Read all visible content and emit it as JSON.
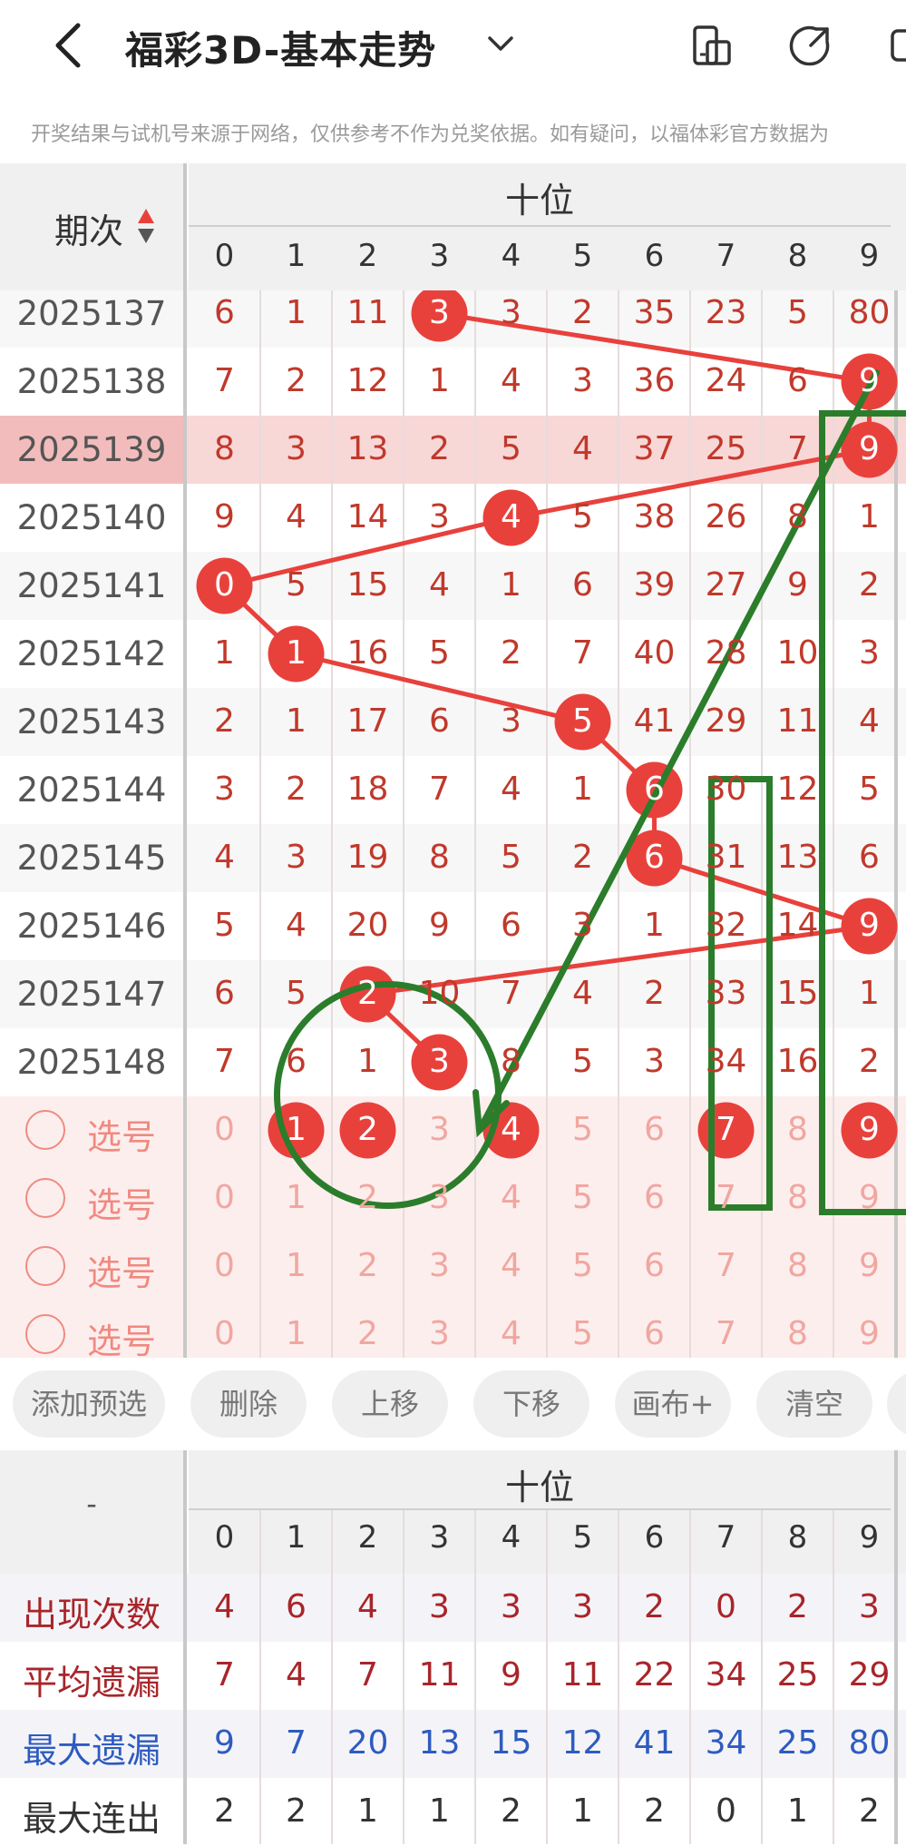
{
  "topbar": {
    "title": "福彩3D-基本走势",
    "back_icon": "chevron-left-icon",
    "dropdown_icon": "chevron-down-icon",
    "icons": [
      "phone-rotate-icon",
      "share-arrow-icon",
      "partial-icon"
    ]
  },
  "notice": "开奖结果与试机号来源于网络，仅供参考不作为兑奖依据。如有疑问，以福体彩官方数据为",
  "grid": {
    "period_header": "期次",
    "group_header": "十位",
    "digits": [
      "0",
      "1",
      "2",
      "3",
      "4",
      "5",
      "6",
      "7",
      "8",
      "9"
    ],
    "rows": [
      {
        "period": "2025137",
        "cells": [
          "6",
          "1",
          "11",
          "3",
          "3",
          "2",
          "35",
          "23",
          "5",
          "80"
        ],
        "hit": 3
      },
      {
        "period": "2025138",
        "cells": [
          "7",
          "2",
          "12",
          "1",
          "4",
          "3",
          "36",
          "24",
          "6",
          "9"
        ],
        "hit": 9
      },
      {
        "period": "2025139",
        "cells": [
          "8",
          "3",
          "13",
          "2",
          "5",
          "4",
          "37",
          "25",
          "7",
          "9"
        ],
        "hit": 9,
        "highlight": true
      },
      {
        "period": "2025140",
        "cells": [
          "9",
          "4",
          "14",
          "3",
          "4",
          "5",
          "38",
          "26",
          "8",
          "1"
        ],
        "hit": 4
      },
      {
        "period": "2025141",
        "cells": [
          "0",
          "5",
          "15",
          "4",
          "1",
          "6",
          "39",
          "27",
          "9",
          "2"
        ],
        "hit": 0
      },
      {
        "period": "2025142",
        "cells": [
          "1",
          "1",
          "16",
          "5",
          "2",
          "7",
          "40",
          "28",
          "10",
          "3"
        ],
        "hit": 1
      },
      {
        "period": "2025143",
        "cells": [
          "2",
          "1",
          "17",
          "6",
          "3",
          "5",
          "41",
          "29",
          "11",
          "4"
        ],
        "hit": 5
      },
      {
        "period": "2025144",
        "cells": [
          "3",
          "2",
          "18",
          "7",
          "4",
          "1",
          "6",
          "30",
          "12",
          "5"
        ],
        "hit": 6
      },
      {
        "period": "2025145",
        "cells": [
          "4",
          "3",
          "19",
          "8",
          "5",
          "2",
          "6",
          "31",
          "13",
          "6"
        ],
        "hit": 6
      },
      {
        "period": "2025146",
        "cells": [
          "5",
          "4",
          "20",
          "9",
          "6",
          "3",
          "1",
          "32",
          "14",
          "9"
        ],
        "hit": 9
      },
      {
        "period": "2025147",
        "cells": [
          "6",
          "5",
          "2",
          "10",
          "7",
          "4",
          "2",
          "33",
          "15",
          "1"
        ],
        "hit": 2
      },
      {
        "period": "2025148",
        "cells": [
          "7",
          "6",
          "1",
          "3",
          "8",
          "5",
          "3",
          "34",
          "16",
          "2"
        ],
        "hit": 3
      }
    ],
    "picks": [
      {
        "label": "选号",
        "selected": [
          1,
          2,
          4,
          7,
          9
        ]
      },
      {
        "label": "选号",
        "selected": []
      },
      {
        "label": "选号",
        "selected": []
      },
      {
        "label": "选号",
        "selected": []
      }
    ]
  },
  "toolbar": {
    "buttons": [
      "添加预选",
      "删除",
      "上移",
      "下移",
      "画布+",
      "清空"
    ]
  },
  "stats": {
    "corner": "-",
    "group_header": "十位",
    "digits": [
      "0",
      "1",
      "2",
      "3",
      "4",
      "5",
      "6",
      "7",
      "8",
      "9"
    ],
    "rows": [
      {
        "label": "出现次数",
        "values": [
          "4",
          "6",
          "4",
          "3",
          "3",
          "3",
          "2",
          "0",
          "2",
          "3"
        ],
        "color": "#a8252a"
      },
      {
        "label": "平均遗漏",
        "values": [
          "7",
          "4",
          "7",
          "11",
          "9",
          "11",
          "22",
          "34",
          "25",
          "29"
        ],
        "color": "#a8252a"
      },
      {
        "label": "最大遗漏",
        "values": [
          "9",
          "7",
          "20",
          "13",
          "15",
          "12",
          "41",
          "34",
          "25",
          "80"
        ],
        "color": "#2e5bbf"
      },
      {
        "label": "最大连出",
        "values": [
          "2",
          "2",
          "1",
          "1",
          "2",
          "1",
          "2",
          "0",
          "1",
          "2"
        ],
        "color": "#333333"
      }
    ]
  },
  "colors": {
    "ball": "#e8413c",
    "trend_line": "#e8413c",
    "annotation": "#2b7d2b",
    "highlight_row": "#f8d7d7",
    "pick_bg": "#fdeeee"
  }
}
